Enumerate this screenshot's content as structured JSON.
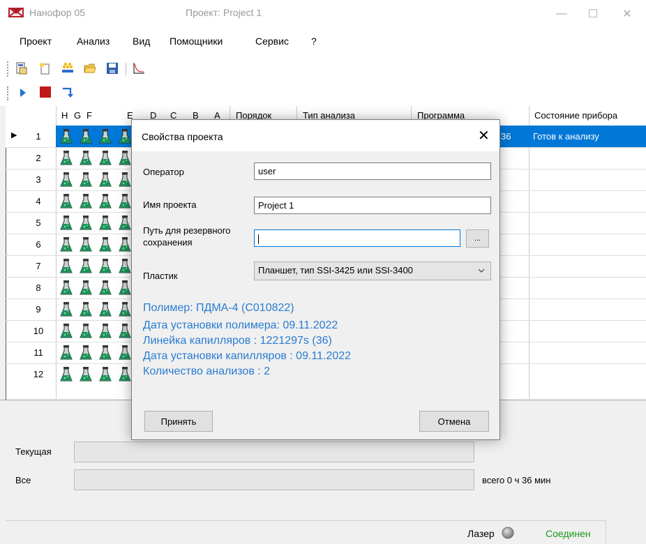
{
  "window": {
    "app_title": "Нанофор 05",
    "project_title": "Проект: Project 1",
    "minimize": "—",
    "maximize": "☐",
    "close": "✕"
  },
  "menu": [
    "Проект",
    "Анализ",
    "Вид",
    "Помощники",
    "Сервис",
    "?"
  ],
  "grid": {
    "columns": {
      "wells": [
        "H",
        "G",
        "F",
        "E",
        "D",
        "C",
        "B",
        "A"
      ],
      "order": "Порядок",
      "analysis_type": "Тип анализа",
      "program": "Программа",
      "status": "Состояние прибора"
    },
    "rows": [
      "1",
      "2",
      "3",
      "4",
      "5",
      "6",
      "7",
      "8",
      "9",
      "10",
      "11",
      "12"
    ],
    "selected_row_indicator": "▶",
    "row1_program_fragment": "36",
    "row1_status": "Готов к анализу"
  },
  "progress": {
    "current_label": "Текущая",
    "all_label": "Все",
    "total_text": "всего 0 ч 36 мин",
    "current_fraction": 0,
    "all_fraction": 0
  },
  "status": {
    "laser_label": "Лазер",
    "connection": "Соединен"
  },
  "dialog": {
    "title": "Свойства проекта",
    "close": "✕",
    "operator_label": "Оператор",
    "operator_value": "user",
    "project_name_label": "Имя проекта",
    "project_name_value": "Project 1",
    "backup_path_label_1": "Путь для резервного",
    "backup_path_label_2": "сохранения",
    "backup_path_value": "",
    "browse_button": "...",
    "plastic_label": "Пластик",
    "plastic_value": "Планшет, тип SSI-3425 или SSI-3400",
    "info": [
      "Полимер: ПДМА-4 (C010822)",
      "Дата установки полимера: 09.11.2022",
      "Линейка капилляров : 1221297s (36)",
      "Дата установки капилляров : 09.11.2022",
      "Количество анализов : 2"
    ],
    "accept_button": "Принять",
    "cancel_button": "Отмена"
  },
  "colors": {
    "selection": "#0078d7",
    "info_text": "#2a7bd1",
    "connected": "#1a9a1a",
    "logo": "#b21e2a"
  }
}
